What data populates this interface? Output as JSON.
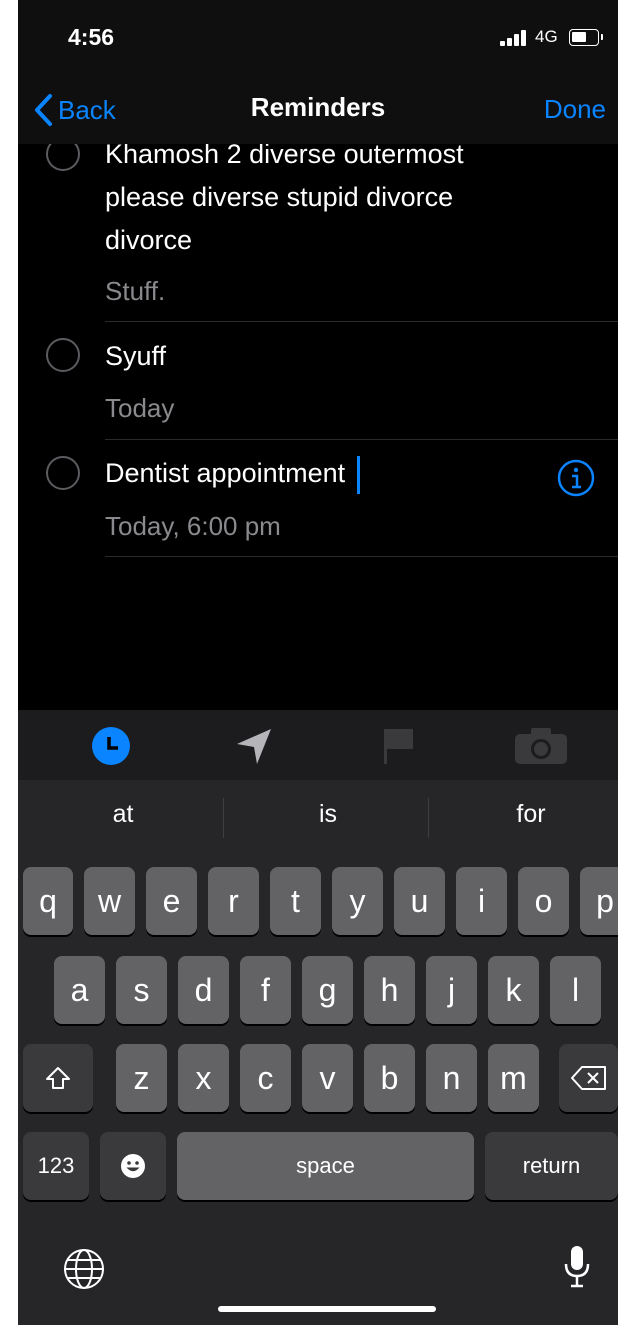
{
  "status_bar": {
    "time": "4:56",
    "network": "4G"
  },
  "nav": {
    "back_label": "Back",
    "title": "Reminders",
    "done_label": "Done"
  },
  "reminders": [
    {
      "title_lines": [
        "Khamosh 2 diverse outermost",
        "please diverse stupid divorce",
        "divorce"
      ],
      "subtitle": "Stuff."
    },
    {
      "title": "Syuff",
      "subtitle": "Today"
    },
    {
      "title": "Dentist appointment",
      "subtitle": "Today, 6:00 pm"
    }
  ],
  "toolbar_icons": [
    "clock-icon",
    "location-arrow-icon",
    "flag-icon",
    "camera-icon"
  ],
  "predictions": [
    "at",
    "is",
    "for"
  ],
  "keyboard": {
    "row1": [
      "q",
      "w",
      "e",
      "r",
      "t",
      "y",
      "u",
      "i",
      "o",
      "p"
    ],
    "row2": [
      "a",
      "s",
      "d",
      "f",
      "g",
      "h",
      "j",
      "k",
      "l"
    ],
    "row3": [
      "z",
      "x",
      "c",
      "v",
      "b",
      "n",
      "m"
    ],
    "numbers_label": "123",
    "space_label": "space",
    "return_label": "return"
  },
  "colors": {
    "accent": "#0a84ff",
    "background": "#000000",
    "key": "#636366",
    "key_dark": "#3a3a3c"
  }
}
